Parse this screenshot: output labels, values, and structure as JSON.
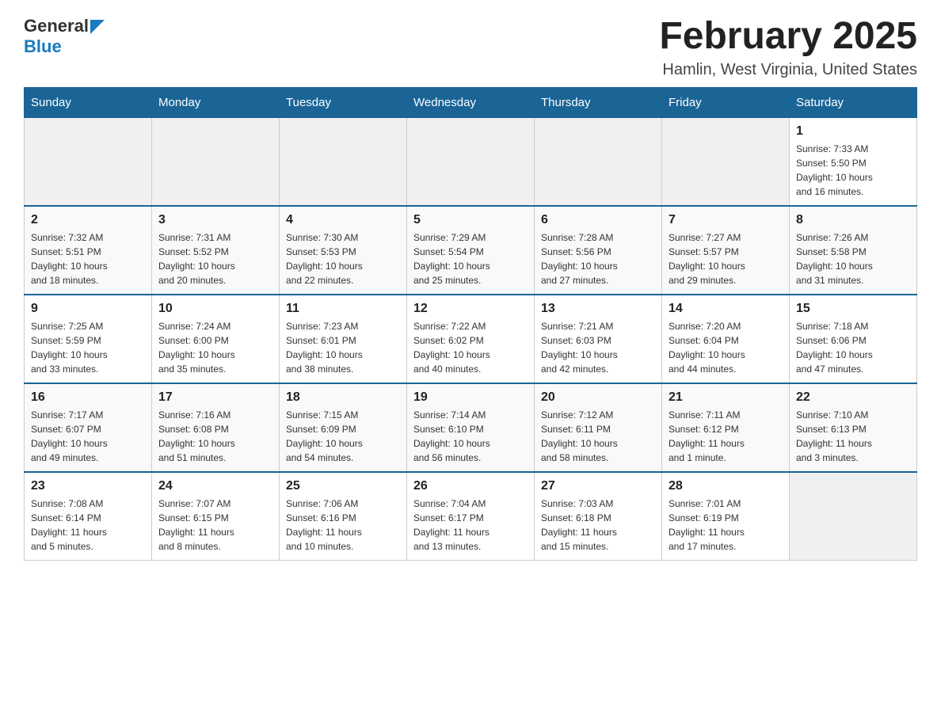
{
  "header": {
    "logo_general": "General",
    "logo_blue": "Blue",
    "month_title": "February 2025",
    "subtitle": "Hamlin, West Virginia, United States"
  },
  "days_of_week": [
    "Sunday",
    "Monday",
    "Tuesday",
    "Wednesday",
    "Thursday",
    "Friday",
    "Saturday"
  ],
  "weeks": [
    [
      {
        "day": "",
        "info": ""
      },
      {
        "day": "",
        "info": ""
      },
      {
        "day": "",
        "info": ""
      },
      {
        "day": "",
        "info": ""
      },
      {
        "day": "",
        "info": ""
      },
      {
        "day": "",
        "info": ""
      },
      {
        "day": "1",
        "info": "Sunrise: 7:33 AM\nSunset: 5:50 PM\nDaylight: 10 hours\nand 16 minutes."
      }
    ],
    [
      {
        "day": "2",
        "info": "Sunrise: 7:32 AM\nSunset: 5:51 PM\nDaylight: 10 hours\nand 18 minutes."
      },
      {
        "day": "3",
        "info": "Sunrise: 7:31 AM\nSunset: 5:52 PM\nDaylight: 10 hours\nand 20 minutes."
      },
      {
        "day": "4",
        "info": "Sunrise: 7:30 AM\nSunset: 5:53 PM\nDaylight: 10 hours\nand 22 minutes."
      },
      {
        "day": "5",
        "info": "Sunrise: 7:29 AM\nSunset: 5:54 PM\nDaylight: 10 hours\nand 25 minutes."
      },
      {
        "day": "6",
        "info": "Sunrise: 7:28 AM\nSunset: 5:56 PM\nDaylight: 10 hours\nand 27 minutes."
      },
      {
        "day": "7",
        "info": "Sunrise: 7:27 AM\nSunset: 5:57 PM\nDaylight: 10 hours\nand 29 minutes."
      },
      {
        "day": "8",
        "info": "Sunrise: 7:26 AM\nSunset: 5:58 PM\nDaylight: 10 hours\nand 31 minutes."
      }
    ],
    [
      {
        "day": "9",
        "info": "Sunrise: 7:25 AM\nSunset: 5:59 PM\nDaylight: 10 hours\nand 33 minutes."
      },
      {
        "day": "10",
        "info": "Sunrise: 7:24 AM\nSunset: 6:00 PM\nDaylight: 10 hours\nand 35 minutes."
      },
      {
        "day": "11",
        "info": "Sunrise: 7:23 AM\nSunset: 6:01 PM\nDaylight: 10 hours\nand 38 minutes."
      },
      {
        "day": "12",
        "info": "Sunrise: 7:22 AM\nSunset: 6:02 PM\nDaylight: 10 hours\nand 40 minutes."
      },
      {
        "day": "13",
        "info": "Sunrise: 7:21 AM\nSunset: 6:03 PM\nDaylight: 10 hours\nand 42 minutes."
      },
      {
        "day": "14",
        "info": "Sunrise: 7:20 AM\nSunset: 6:04 PM\nDaylight: 10 hours\nand 44 minutes."
      },
      {
        "day": "15",
        "info": "Sunrise: 7:18 AM\nSunset: 6:06 PM\nDaylight: 10 hours\nand 47 minutes."
      }
    ],
    [
      {
        "day": "16",
        "info": "Sunrise: 7:17 AM\nSunset: 6:07 PM\nDaylight: 10 hours\nand 49 minutes."
      },
      {
        "day": "17",
        "info": "Sunrise: 7:16 AM\nSunset: 6:08 PM\nDaylight: 10 hours\nand 51 minutes."
      },
      {
        "day": "18",
        "info": "Sunrise: 7:15 AM\nSunset: 6:09 PM\nDaylight: 10 hours\nand 54 minutes."
      },
      {
        "day": "19",
        "info": "Sunrise: 7:14 AM\nSunset: 6:10 PM\nDaylight: 10 hours\nand 56 minutes."
      },
      {
        "day": "20",
        "info": "Sunrise: 7:12 AM\nSunset: 6:11 PM\nDaylight: 10 hours\nand 58 minutes."
      },
      {
        "day": "21",
        "info": "Sunrise: 7:11 AM\nSunset: 6:12 PM\nDaylight: 11 hours\nand 1 minute."
      },
      {
        "day": "22",
        "info": "Sunrise: 7:10 AM\nSunset: 6:13 PM\nDaylight: 11 hours\nand 3 minutes."
      }
    ],
    [
      {
        "day": "23",
        "info": "Sunrise: 7:08 AM\nSunset: 6:14 PM\nDaylight: 11 hours\nand 5 minutes."
      },
      {
        "day": "24",
        "info": "Sunrise: 7:07 AM\nSunset: 6:15 PM\nDaylight: 11 hours\nand 8 minutes."
      },
      {
        "day": "25",
        "info": "Sunrise: 7:06 AM\nSunset: 6:16 PM\nDaylight: 11 hours\nand 10 minutes."
      },
      {
        "day": "26",
        "info": "Sunrise: 7:04 AM\nSunset: 6:17 PM\nDaylight: 11 hours\nand 13 minutes."
      },
      {
        "day": "27",
        "info": "Sunrise: 7:03 AM\nSunset: 6:18 PM\nDaylight: 11 hours\nand 15 minutes."
      },
      {
        "day": "28",
        "info": "Sunrise: 7:01 AM\nSunset: 6:19 PM\nDaylight: 11 hours\nand 17 minutes."
      },
      {
        "day": "",
        "info": ""
      }
    ]
  ]
}
